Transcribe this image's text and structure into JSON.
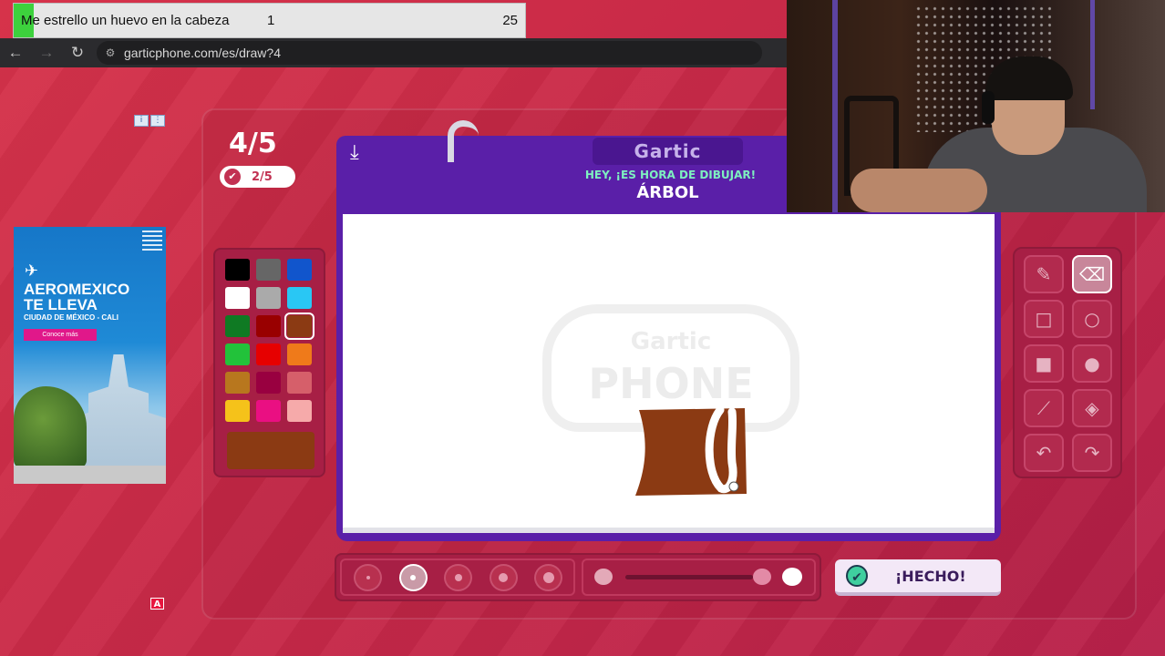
{
  "overlay": {
    "title": "Me estrello un huevo en la cabeza",
    "count_a": "1",
    "count_b": "25"
  },
  "browser": {
    "back_icon": "arrow-left-icon",
    "back_glyph": "←",
    "forward_icon": "arrow-right-icon",
    "forward_glyph": "→",
    "reload_icon": "reload-icon",
    "reload_glyph": "↻",
    "site_info_icon": "site-settings-icon",
    "site_info_glyph": "⚙",
    "url": "garticphone.com/es/draw?4"
  },
  "game": {
    "round": "4/5",
    "done_count": "2/5",
    "brand": "Gartic",
    "prompt_label": "HEY, ¡ES HORA DE DIBUJAR!",
    "prompt_word": "ÁRBOL",
    "done_button": "¡HECHO!",
    "watermark_top": "Gartic",
    "watermark_bottom": "PHONE"
  },
  "ad": {
    "headline_1": "AEROMEXICO",
    "headline_2": "TE LLEVA",
    "subline": "CIUDAD DE MÉXICO - CALI",
    "cta": "Conoce más",
    "badge": "A"
  },
  "palette": {
    "colors": [
      "#000000",
      "#666666",
      "#1155cc",
      "#ffffff",
      "#aaaaaa",
      "#29c7f4",
      "#0f7a23",
      "#990000",
      "#8b3a13",
      "#22c23a",
      "#e60000",
      "#ef7a1a",
      "#b8771e",
      "#990040",
      "#d65f6a",
      "#f5c21a",
      "#ea0f82",
      "#f6aaaa"
    ],
    "selected_index": 8,
    "current_color": "#8b3a13"
  },
  "tools": {
    "items": [
      {
        "name": "pencil-tool",
        "icon": "pencil-icon",
        "glyph": "✎"
      },
      {
        "name": "eraser-tool",
        "icon": "eraser-icon",
        "glyph": "⌫"
      },
      {
        "name": "rectangle-outline-tool",
        "icon": "square-outline-icon",
        "glyph": "□"
      },
      {
        "name": "ellipse-outline-tool",
        "icon": "circle-outline-icon",
        "glyph": "○"
      },
      {
        "name": "rectangle-fill-tool",
        "icon": "square-filled-icon",
        "glyph": "■"
      },
      {
        "name": "ellipse-fill-tool",
        "icon": "circle-filled-icon",
        "glyph": "●"
      },
      {
        "name": "line-tool",
        "icon": "line-icon",
        "glyph": "⟋"
      },
      {
        "name": "fill-bucket-tool",
        "icon": "bucket-icon",
        "glyph": "◈"
      },
      {
        "name": "undo-tool",
        "icon": "undo-icon",
        "glyph": "↶"
      },
      {
        "name": "redo-tool",
        "icon": "redo-icon",
        "glyph": "↷"
      }
    ],
    "active_index": 1
  },
  "brush": {
    "sizes": 5,
    "active_size_index": 1
  },
  "colors": {
    "background": "#c92a48",
    "board": "#5a1fa8",
    "prompt_accent": "#7ef0c0",
    "done_check": "#3fcf9f"
  }
}
